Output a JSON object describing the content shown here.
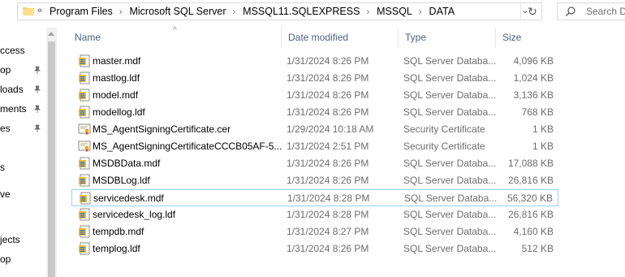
{
  "address": {
    "overflow": "«",
    "crumbs": [
      "Program Files",
      "Microsoft SQL Server",
      "MSSQL11.SQLEXPRESS",
      "MSSQL",
      "DATA"
    ],
    "search_placeholder": "Search D"
  },
  "nav": {
    "items": [
      {
        "label": "ccess",
        "pinned": false
      },
      {
        "label": "op",
        "pinned": true
      },
      {
        "label": "loads",
        "pinned": true
      },
      {
        "label": "ments",
        "pinned": true
      },
      {
        "label": "es",
        "pinned": true
      },
      {
        "label": "s",
        "pinned": false
      },
      {
        "label": "ve",
        "pinned": false
      },
      {
        "label": "jects",
        "pinned": false
      },
      {
        "label": "op",
        "pinned": false
      }
    ]
  },
  "columns": {
    "name": "Name",
    "date": "Date modified",
    "type": "Type",
    "size": "Size"
  },
  "files": [
    {
      "name": "master.mdf",
      "date": "1/31/2024 8:26 PM",
      "type": "SQL Server Databa...",
      "size": "4,096 KB",
      "icon": "sql-file-icon",
      "selected": false
    },
    {
      "name": "mastlog.ldf",
      "date": "1/31/2024 8:26 PM",
      "type": "SQL Server Databa...",
      "size": "1,024 KB",
      "icon": "sql-file-icon",
      "selected": false
    },
    {
      "name": "model.mdf",
      "date": "1/31/2024 8:26 PM",
      "type": "SQL Server Databa...",
      "size": "3,136 KB",
      "icon": "sql-file-icon",
      "selected": false
    },
    {
      "name": "modellog.ldf",
      "date": "1/31/2024 8:26 PM",
      "type": "SQL Server Databa...",
      "size": "768 KB",
      "icon": "sql-file-icon",
      "selected": false
    },
    {
      "name": "MS_AgentSigningCertificate.cer",
      "date": "1/29/2024 10:18 AM",
      "type": "Security Certificate",
      "size": "1 KB",
      "icon": "certificate-icon",
      "selected": false
    },
    {
      "name": "MS_AgentSigningCertificateCCCB05AF-5...",
      "date": "1/31/2024 2:51 PM",
      "type": "Security Certificate",
      "size": "1 KB",
      "icon": "certificate-icon",
      "selected": false
    },
    {
      "name": "MSDBData.mdf",
      "date": "1/31/2024 8:26 PM",
      "type": "SQL Server Databa...",
      "size": "17,088 KB",
      "icon": "sql-file-icon",
      "selected": false
    },
    {
      "name": "MSDBLog.ldf",
      "date": "1/31/2024 8:26 PM",
      "type": "SQL Server Databa...",
      "size": "26,816 KB",
      "icon": "sql-file-icon",
      "selected": false
    },
    {
      "name": "servicedesk.mdf",
      "date": "1/31/2024 8:28 PM",
      "type": "SQL Server Databa...",
      "size": "56,320 KB",
      "icon": "sql-file-icon",
      "selected": true
    },
    {
      "name": "servicedesk_log.ldf",
      "date": "1/31/2024 8:28 PM",
      "type": "SQL Server Databa...",
      "size": "26,816 KB",
      "icon": "sql-file-icon",
      "selected": false
    },
    {
      "name": "tempdb.mdf",
      "date": "1/31/2024 8:27 PM",
      "type": "SQL Server Databa...",
      "size": "4,160 KB",
      "icon": "sql-file-icon",
      "selected": false
    },
    {
      "name": "templog.ldf",
      "date": "1/31/2024 8:26 PM",
      "type": "SQL Server Databa...",
      "size": "512 KB",
      "icon": "sql-file-icon",
      "selected": false
    }
  ],
  "colors": {
    "selection_border": "#99d1ff",
    "header_text": "#4c607a",
    "secondary_text": "#6d6d6d"
  }
}
